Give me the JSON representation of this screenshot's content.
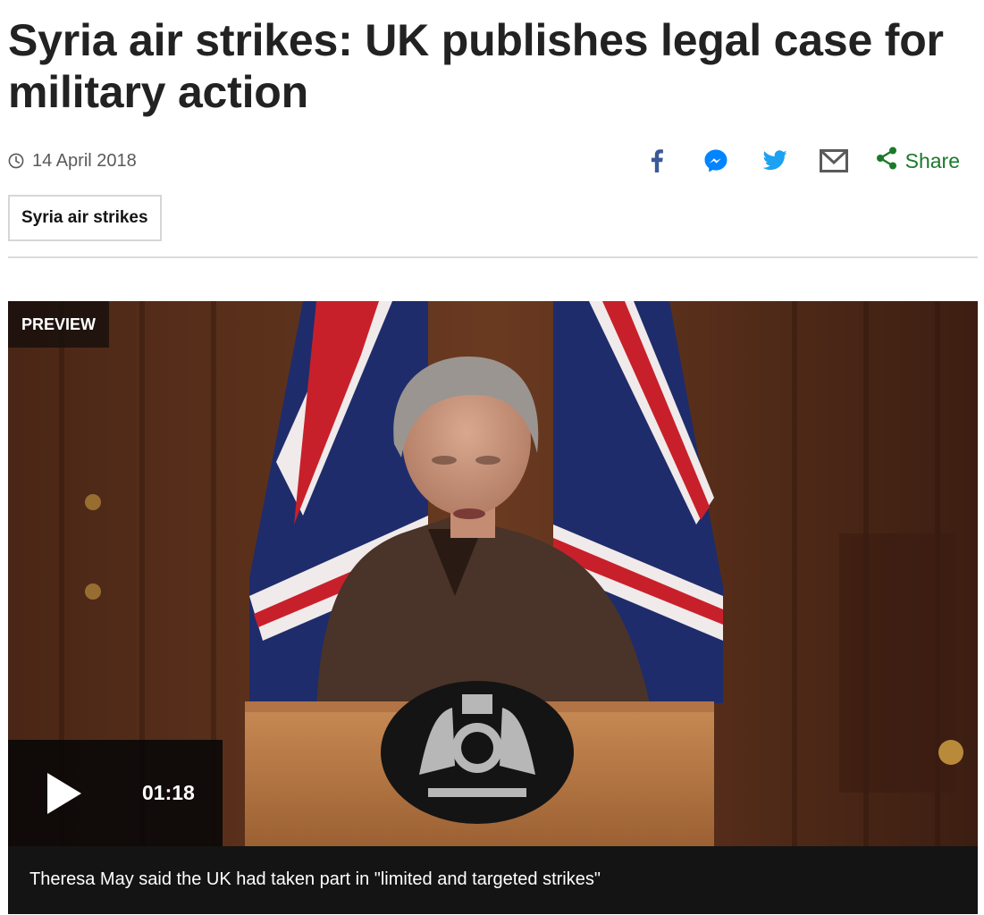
{
  "article": {
    "headline": "Syria air strikes: UK publishes legal case for military action",
    "date": "14 April 2018"
  },
  "share": {
    "icons": [
      "facebook-icon",
      "messenger-icon",
      "twitter-icon",
      "email-icon",
      "share-icon"
    ],
    "label": "Share",
    "colors": {
      "facebook": "#3b5998",
      "messenger": "#0084ff",
      "twitter": "#1da1f2",
      "email": "#5a5a5a",
      "share": "#1a7a2a"
    }
  },
  "topic": {
    "label": "Syria air strikes"
  },
  "media": {
    "badge": "PREVIEW",
    "duration": "01:18",
    "caption": "Theresa May said the UK had taken part in \"limited and targeted strikes\""
  }
}
